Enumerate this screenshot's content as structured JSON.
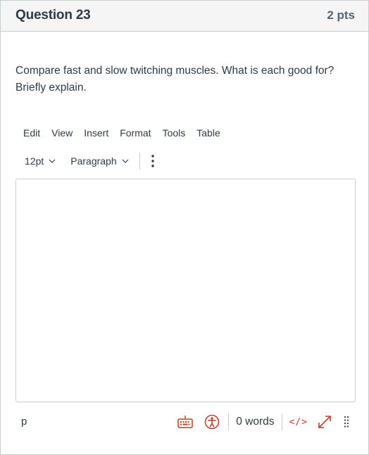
{
  "question": {
    "title": "Question 23",
    "points": "2 pts",
    "text": "Compare fast and slow twitching muscles. What is each good for? Briefly explain."
  },
  "editor": {
    "menu": [
      "Edit",
      "View",
      "Insert",
      "Format",
      "Tools",
      "Table"
    ],
    "font_size": "12pt",
    "block_format": "Paragraph",
    "content": "",
    "status": {
      "path": "p",
      "word_count": "0 words",
      "html_toggle": "</>"
    }
  },
  "colors": {
    "accent": "#c23c2d",
    "text": "#2d3b45",
    "header_bg": "#f5f5f5",
    "border": "#c7cdd1"
  },
  "icons": [
    "chevron-down-icon",
    "more-vertical-icon",
    "keyboard-icon",
    "accessibility-icon",
    "fullscreen-icon",
    "resize-handle-icon"
  ]
}
